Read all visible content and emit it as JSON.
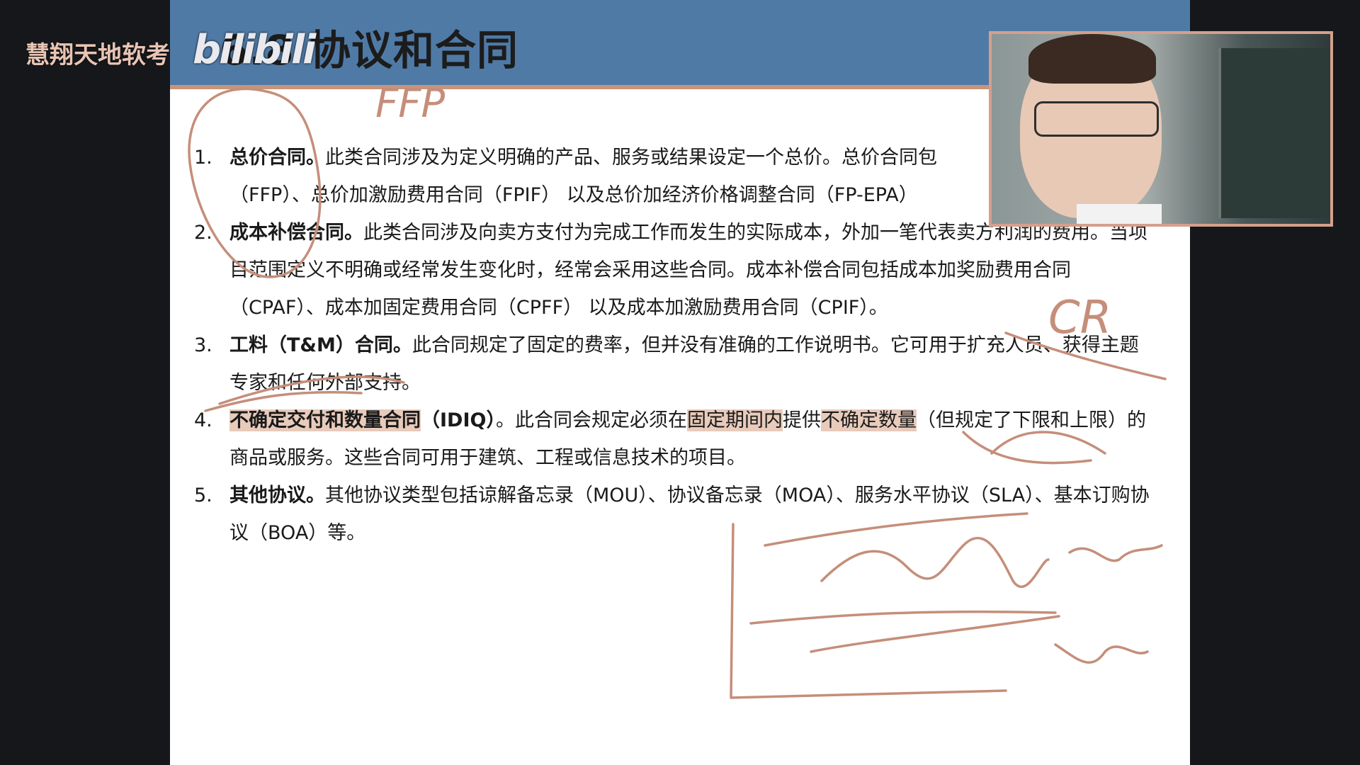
{
  "channel": {
    "name": "慧翔天地软考",
    "platform_logo": "bilibili"
  },
  "slide": {
    "title": "6.8 协议和合同",
    "items": [
      {
        "num": "1.",
        "term": "总价合同。",
        "text": "此类合同涉及为定义明确的产品、服务或结果设定一个总价。总价合同包",
        "line2": "（FFP）、总价加激励费用合同（FPIF） 以及总价加经济价格调整合同（FP-EPA）"
      },
      {
        "num": "2.",
        "term": "成本补偿合同。",
        "text": "此类合同涉及向卖方支付为完成工作而发生的实际成本，外加一笔代表卖方利润的费用。当项目范围定义不明确或经常发生变化时，经常会采用这些合同。成本补偿合同包括成本加奖励费用合同（CPAF）、成本加固定费用合同（CPFF） 以及成本加激励费用合同（CPIF）。"
      },
      {
        "num": "3.",
        "term": "工料（T&M）合同。",
        "text": "此合同规定了固定的费率，但并没有准确的工作说明书。它可用于扩充人员、获得主题专家和任何外部支持。"
      },
      {
        "num": "4.",
        "term": "不确定交付和数量合同",
        "term_suffix": "（IDIQ）",
        "text_a": "。此合同会规定必须在",
        "hl_1": "固定期间内",
        "text_b": "提供",
        "hl_2": "不确定数量",
        "text_c": "（但规定了下限和上限）的商品或服务。这些合同可用于建筑、工程或信息技术的项目。"
      },
      {
        "num": "5.",
        "term": "其他协议。",
        "text": "其他协议类型包括谅解备忘录（MOU）、协议备忘录（MOA）、服务水平协议（SLA）、基本订购协议（BOA）等。"
      }
    ]
  },
  "annotations": {
    "note_1": "FFP",
    "note_2": "CR"
  },
  "webcam": {
    "icon": "presenter-video"
  },
  "colors": {
    "header": "#4f7aa6",
    "ink": "#c58e7a",
    "highlight": "#d6a084",
    "background": "#15171b"
  }
}
